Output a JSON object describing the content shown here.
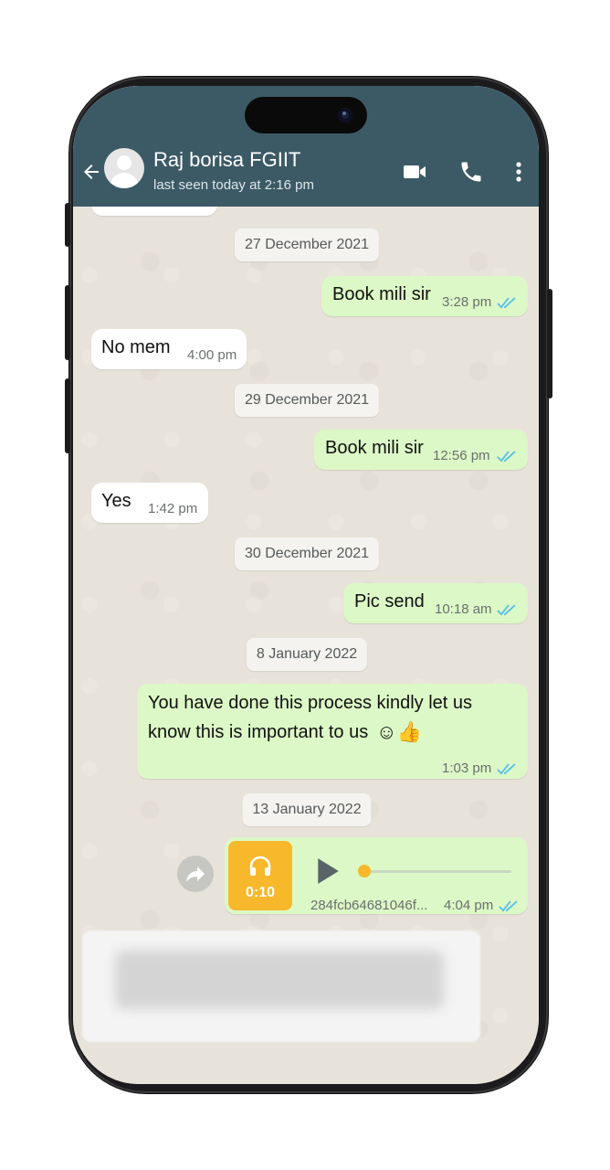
{
  "header": {
    "contact_name": "Raj borisa FGIIT",
    "last_seen": "last seen today at 2:16 pm"
  },
  "messages": [
    {
      "type": "date",
      "text": "27 December 2021"
    },
    {
      "type": "out",
      "text": "Book mili sir",
      "time": "3:28 pm"
    },
    {
      "type": "in",
      "text": "No mem",
      "time": "4:00 pm"
    },
    {
      "type": "date",
      "text": "29 December 2021"
    },
    {
      "type": "out",
      "text": "Book mili sir",
      "time": "12:56 pm"
    },
    {
      "type": "in",
      "text": "Yes",
      "time": "1:42 pm"
    },
    {
      "type": "date",
      "text": "30 December 2021"
    },
    {
      "type": "out",
      "text": "Pic send",
      "time": "10:18 am"
    },
    {
      "type": "date",
      "text": "8 January 2022"
    },
    {
      "type": "out",
      "line1": "You have done this process kindly let us",
      "line2": "know this is important to us",
      "emoji": "☺👍",
      "time": "1:03 pm"
    },
    {
      "type": "date",
      "text": "13 January 2022"
    },
    {
      "type": "audio",
      "duration": "0:10",
      "filename": "284fcb64681046f...",
      "time": "4:04 pm"
    }
  ],
  "partial_top_time": "3:?? pm",
  "colors": {
    "header_bg": "#3c5a66",
    "outgoing_bubble": "#dcf8c6",
    "incoming_bubble": "#ffffff",
    "tick_blue": "#53bdeb",
    "audio_accent": "#f8b82c"
  },
  "icons": [
    "back-arrow-icon",
    "avatar-placeholder-icon",
    "video-call-icon",
    "voice-call-icon",
    "more-options-icon",
    "double-tick-icon",
    "play-icon",
    "headphones-icon",
    "forward-icon"
  ]
}
